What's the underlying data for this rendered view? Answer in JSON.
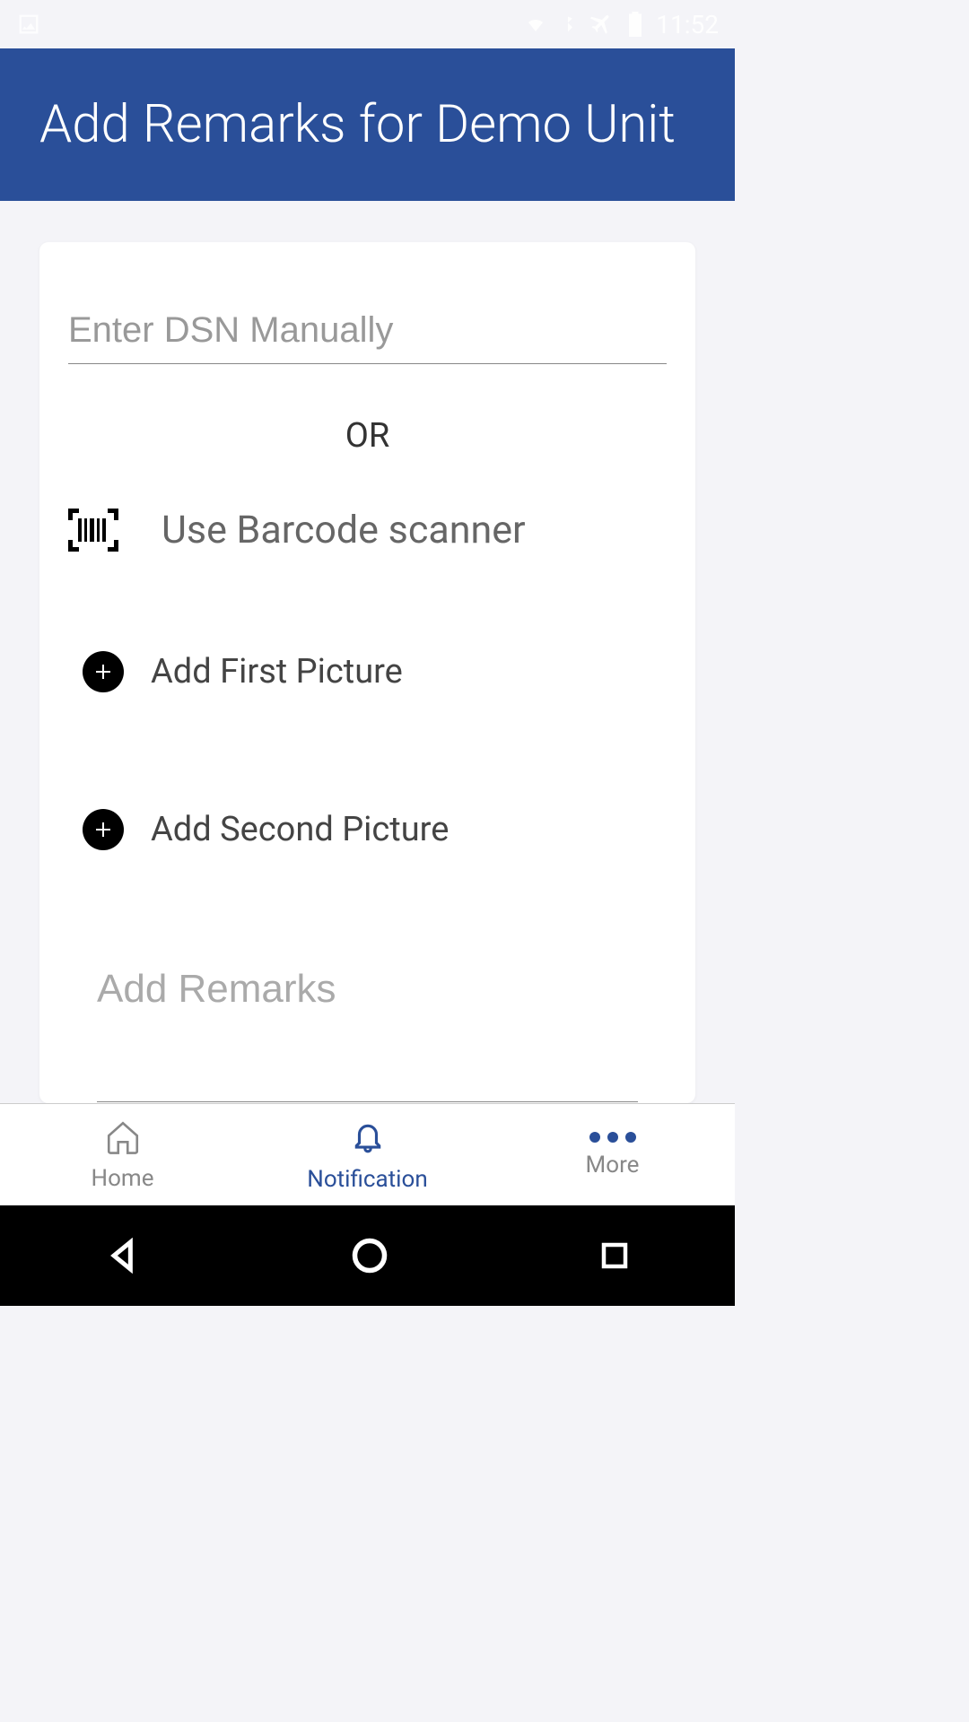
{
  "status": {
    "time": "11:52"
  },
  "header": {
    "title": "Add Remarks for Demo Unit"
  },
  "form": {
    "dsn_placeholder": "Enter DSN Manually",
    "or_label": "OR",
    "barcode_label": "Use Barcode scanner",
    "add_first_picture_label": "Add First Picture",
    "add_second_picture_label": "Add Second Picture",
    "remarks_placeholder": "Add Remarks"
  },
  "tabs": {
    "home": "Home",
    "notification": "Notification",
    "more": "More"
  }
}
